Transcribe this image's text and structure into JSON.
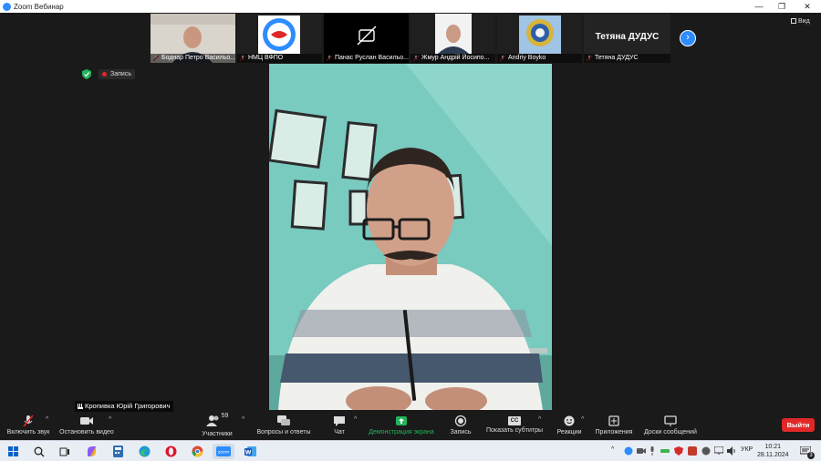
{
  "window": {
    "title": "Zoom Вебинар"
  },
  "participants": [
    {
      "name": "Боднар Петро Васильо..."
    },
    {
      "name": "НМЦ ВФПО"
    },
    {
      "name": "Панас Руслан Васильо..."
    },
    {
      "name": "Жмур Андрій Йосипо..."
    },
    {
      "name": "Andriy Boyko"
    },
    {
      "name": "Тетяна ДУДУС",
      "display": "Тетяна ДУДУС"
    }
  ],
  "view_label": "Вид",
  "recording_label": "Запись",
  "active_speaker": "Кропивка Юрій Григорович",
  "toolbar": {
    "mic": "Включить звук",
    "video": "Остановить видео",
    "participants": "Участники",
    "participants_count": "59",
    "qa": "Вопросы и ответы",
    "chat": "Чат",
    "share": "Демонстрация экрана",
    "record": "Запись",
    "captions": "Показать субтитры",
    "captions_badge": "CC",
    "reactions": "Реакции",
    "apps": "Приложения",
    "whiteboards": "Доски сообщений",
    "leave": "Выйти"
  },
  "taskbar": {
    "language": "УКР",
    "time": "10:21",
    "date": "28.11.2024",
    "notification_count": "3"
  },
  "colors": {
    "accent": "#2d8cff",
    "share_green": "#23b35a",
    "leave_red": "#e02828",
    "wall": "#79cabf"
  }
}
